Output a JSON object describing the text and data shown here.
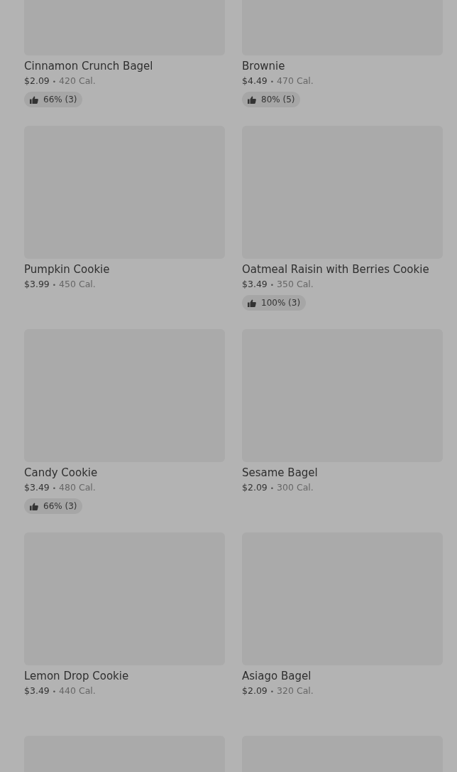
{
  "items": [
    {
      "image": {
        "kind": "placeholder"
      },
      "name": "Cinnamon Crunch Bagel",
      "price": "$2.09",
      "separator": "•",
      "calories": "420 Cal.",
      "rating": "66% (3)"
    },
    {
      "image": {
        "kind": "placeholder"
      },
      "name": "Brownie",
      "price": "$4.49",
      "separator": "•",
      "calories": "470 Cal.",
      "rating": "80% (5)"
    },
    {
      "image": {
        "kind": "placeholder"
      },
      "name": "Pumpkin Cookie",
      "price": "$3.99",
      "separator": "•",
      "calories": "450 Cal."
    },
    {
      "image": {
        "kind": "placeholder"
      },
      "name": "Oatmeal Raisin with Berries Cookie",
      "price": "$3.49",
      "separator": "•",
      "calories": "350 Cal.",
      "rating": "100% (3)"
    },
    {
      "image": {
        "kind": "placeholder"
      },
      "name": "Candy Cookie",
      "price": "$3.49",
      "separator": "•",
      "calories": "480 Cal.",
      "rating": "66% (3)"
    },
    {
      "image": {
        "kind": "placeholder"
      },
      "name": "Sesame Bagel",
      "price": "$2.09",
      "separator": "•",
      "calories": "300 Cal."
    },
    {
      "image": {
        "kind": "placeholder"
      },
      "name": "Lemon Drop Cookie",
      "price": "$3.49",
      "separator": "•",
      "calories": "440 Cal."
    },
    {
      "image": {
        "kind": "placeholder"
      },
      "name": "Asiago Bagel",
      "price": "$2.09",
      "separator": "•",
      "calories": "320 Cal."
    },
    {
      "image": {
        "kind": "placeholder"
      }
    },
    {
      "image": {
        "kind": "placeholder"
      }
    }
  ]
}
